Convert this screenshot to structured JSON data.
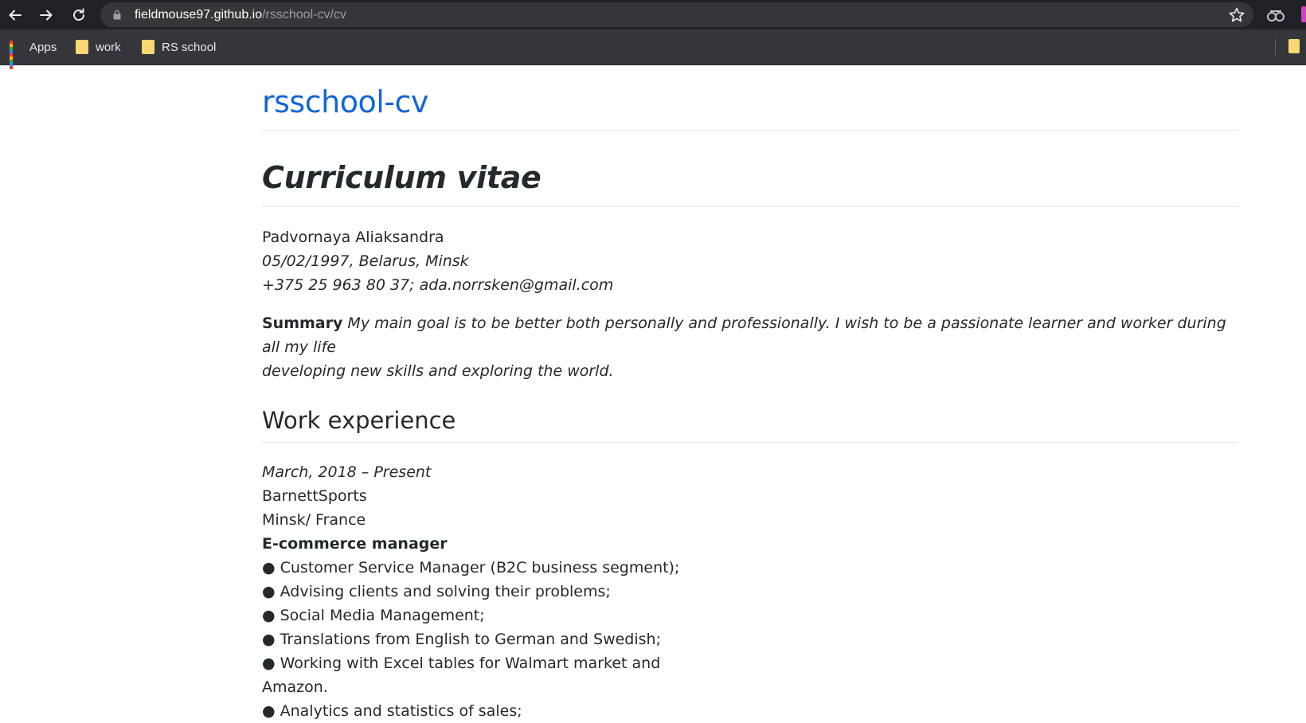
{
  "browser": {
    "url_host": "fieldmouse97.github.io",
    "url_path": "/rsschool-cv/cv",
    "bookmarks": [
      {
        "label": "Apps"
      },
      {
        "label": "work"
      },
      {
        "label": "RS school"
      }
    ]
  },
  "page": {
    "site_title": "rsschool-cv",
    "cv_title": "Curriculum vitae",
    "name": "Padvornaya Aliaksandra",
    "birth_location": "05/02/1997, Belarus, Minsk",
    "contacts": "+375 25 963 80 37; ada.norrsken@gmail.com",
    "summary_label": "Summary",
    "summary_text_line1": " My main goal is to be better both personally and professionally. I wish to be a passionate learner and worker during all my life",
    "summary_text_line2": "developing new skills and exploring the world.",
    "work_heading": "Work experience",
    "work": {
      "period": "March, 2018 – Present",
      "company": "BarnettSports",
      "location": "Minsk/ France",
      "position": "E-commerce manager",
      "duties": [
        "● Customer Service Manager (B2C business segment);",
        "● Advising clients and solving their problems;",
        "● Social Media Management;",
        "● Translations from English to German and Swedish;",
        "● Working with Excel tables for Walmart market and",
        "Amazon.",
        "● Analytics and statistics of sales;"
      ]
    }
  }
}
